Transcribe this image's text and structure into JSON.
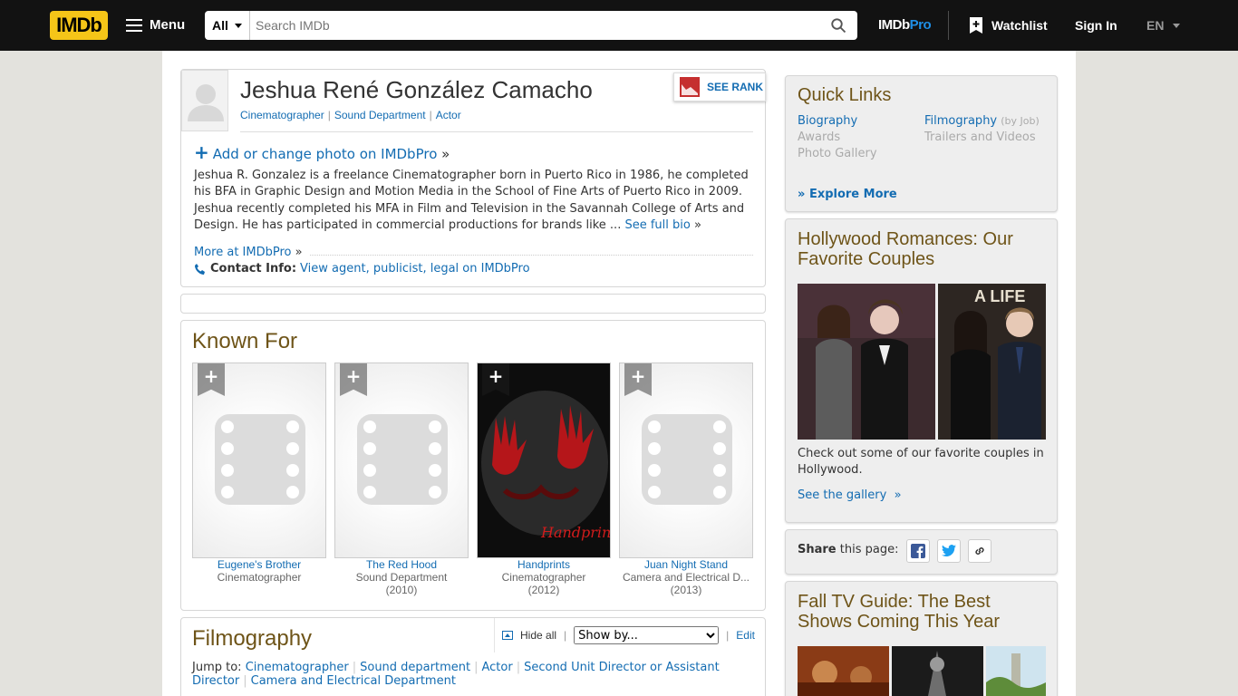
{
  "header": {
    "logo_text": "IMDb",
    "menu_label": "Menu",
    "search_category": "All",
    "search_placeholder": "Search IMDb",
    "imdbpro_label": "IMDb",
    "imdbpro_suffix": "Pro",
    "watchlist_label": "Watchlist",
    "signin_label": "Sign In",
    "language": "EN"
  },
  "person": {
    "name": "Jeshua René González Camacho",
    "jobs": [
      "Cinematographer",
      "Sound Department",
      "Actor"
    ],
    "see_rank_label": "SEE RANK",
    "add_photo_label": "Add or change photo on IMDbPro",
    "bio": "Jeshua R. Gonzalez is a freelance Cinematographer born in Puerto Rico in 1986, he completed his BFA in Graphic Design and Motion Media in the School of Fine Arts of Puerto Rico in 2009. Jeshua recently completed his MFA in Film and Television in the Savannah College of Arts and Design. He has participated in commercial productions for brands like ...",
    "see_full_bio": "See full bio",
    "more_at_pro": "More at IMDbPro",
    "contact_label": "Contact Info:",
    "contact_link": "View agent, publicist, legal on IMDbPro"
  },
  "known_for": {
    "heading": "Known For",
    "items": [
      {
        "title": "Eugene's Brother",
        "role": "Cinematographer",
        "year": ""
      },
      {
        "title": "The Red Hood",
        "role": "Sound Department",
        "year": "(2010)"
      },
      {
        "title": "Handprints",
        "role": "Cinematographer",
        "year": "(2012)",
        "poster_text": "Handprints"
      },
      {
        "title": "Juan Night Stand",
        "role": "Camera and Electrical D...",
        "year": "(2013)"
      }
    ]
  },
  "filmography": {
    "heading": "Filmography",
    "hide_all": "Hide all",
    "show_by": "Show by...",
    "edit": "Edit",
    "jump_to_label": "Jump to:",
    "jump_links": [
      "Cinematographer",
      "Sound department",
      "Actor",
      "Second Unit Director or Assistant Director",
      "Camera and Electrical Department"
    ]
  },
  "quick_links": {
    "heading": "Quick Links",
    "biography": "Biography",
    "filmography": "Filmography",
    "by_job": "(by Job)",
    "awards": "Awards",
    "trailers": "Trailers and Videos",
    "photo_gallery": "Photo Gallery",
    "explore_more": "Explore More"
  },
  "romances": {
    "heading": "Hollywood Romances: Our Favorite Couples",
    "caption": "Check out some of our favorite couples in Hollywood.",
    "gallery_link": "See the gallery",
    "photo_text": "A LIFE"
  },
  "share": {
    "label_bold": "Share",
    "label_rest": "this page:"
  },
  "fall_tv": {
    "heading": "Fall TV Guide: The Best Shows Coming This Year"
  },
  "colors": {
    "imdb_yellow": "#f5c518",
    "link_blue": "#136cb2",
    "heading_brown": "#6e5418",
    "header_bg": "#121212"
  }
}
